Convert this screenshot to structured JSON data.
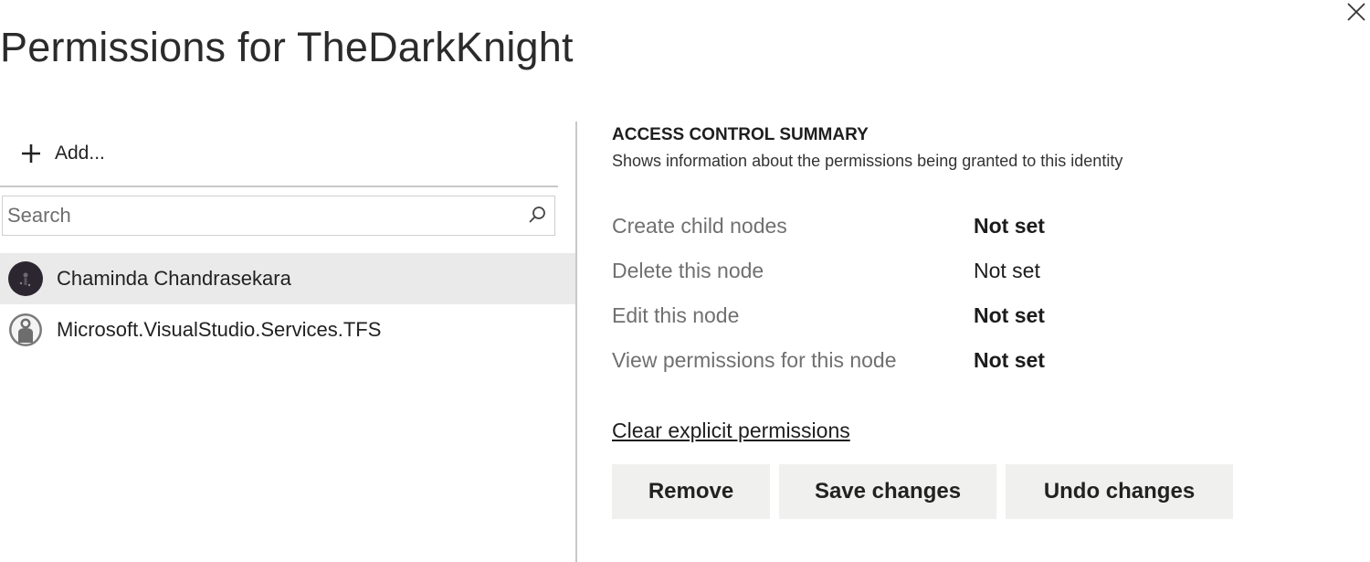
{
  "dialog": {
    "title": "Permissions for TheDarkKnight",
    "close_icon": "close-icon"
  },
  "left_panel": {
    "add_label": "Add...",
    "add_icon": "plus-icon",
    "search": {
      "placeholder": "Search",
      "value": "",
      "icon": "search-icon"
    },
    "identities": [
      {
        "name": "Chaminda Chandrasekara",
        "avatar": "user-photo-avatar",
        "selected": true
      },
      {
        "name": "Microsoft.VisualStudio.Services.TFS",
        "avatar": "service-identity-avatar",
        "selected": false
      }
    ]
  },
  "right_panel": {
    "summary_title": "ACCESS CONTROL SUMMARY",
    "summary_subtitle": "Shows information about the permissions being granted to this identity",
    "permissions": [
      {
        "name": "Create child nodes",
        "value": "Not set",
        "bold": true
      },
      {
        "name": "Delete this node",
        "value": "Not set",
        "bold": false
      },
      {
        "name": "Edit this node",
        "value": "Not set",
        "bold": true
      },
      {
        "name": "View permissions for this node",
        "value": "Not set",
        "bold": true
      }
    ],
    "clear_link": "Clear explicit permissions",
    "buttons": {
      "remove": "Remove",
      "save": "Save changes",
      "undo": "Undo changes"
    }
  },
  "colors": {
    "selected_row": "#eaeaea",
    "button_bg": "#f0f0ee",
    "divider": "#c8c8c8",
    "muted_text": "#707070"
  }
}
